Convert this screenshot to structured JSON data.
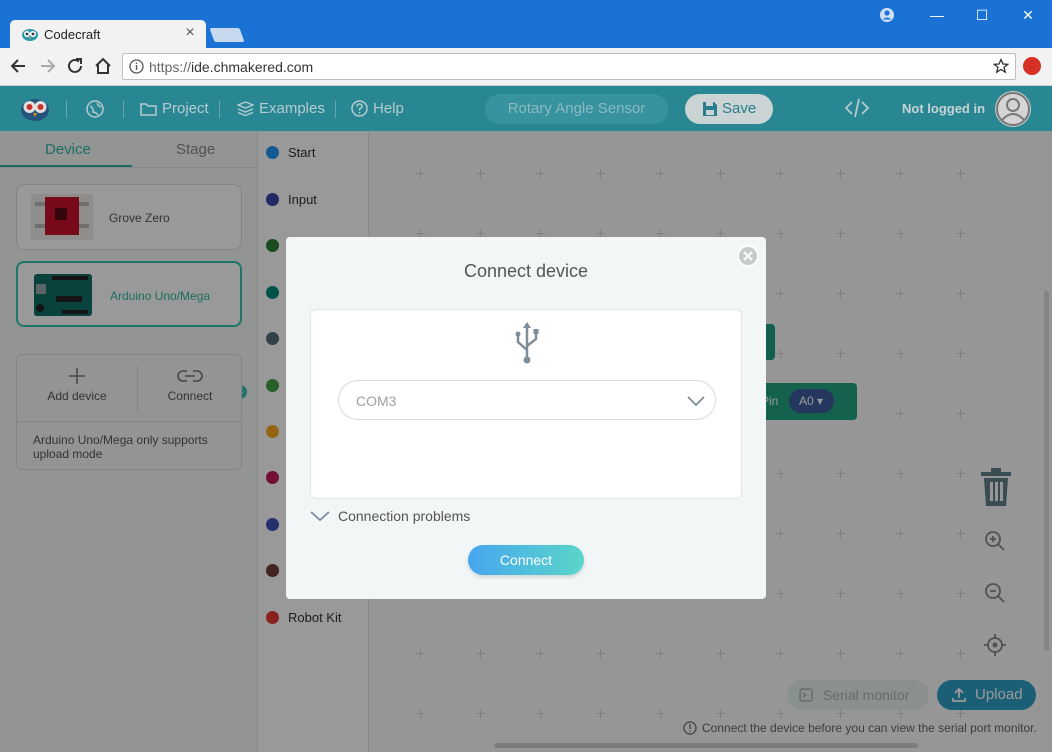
{
  "browser": {
    "tab_title": "Codecraft",
    "tab_close": "×",
    "url_protocol": "https://",
    "url_host": "ide.chmakered.com",
    "window_minimize": "—",
    "window_maximize": "☐",
    "window_close": "✕"
  },
  "header": {
    "menu": [
      {
        "label": "Project",
        "icon": "folder-icon"
      },
      {
        "label": "Examples",
        "icon": "layers-icon"
      },
      {
        "label": "Help",
        "icon": "help-icon"
      }
    ],
    "device_name": "Rotary Angle Sensor",
    "save_label": "Save",
    "login_status": "Not logged in"
  },
  "left_panel": {
    "tabs": [
      {
        "label": "Device",
        "active": true
      },
      {
        "label": "Stage",
        "active": false
      }
    ],
    "devices": [
      {
        "name": "Grove Zero",
        "selected": false
      },
      {
        "name": "Arduino Uno/Mega",
        "selected": true
      }
    ],
    "add_device_label": "Add device",
    "connect_label": "Connect",
    "note": "Arduino Uno/Mega  only supports upload mode"
  },
  "categories": [
    {
      "label": "Start",
      "color": "#2196f3"
    },
    {
      "label": "Input",
      "color": "#3949ab"
    },
    {
      "label": "",
      "color": "#2e7d32"
    },
    {
      "label": "",
      "color": "#00897b"
    },
    {
      "label": "",
      "color": "#546e7a"
    },
    {
      "label": "",
      "color": "#43a047"
    },
    {
      "label": "",
      "color": "#f9a825"
    },
    {
      "label": "",
      "color": "#c2185b"
    },
    {
      "label": "",
      "color": "#3f51b5"
    },
    {
      "label": "",
      "color": "#6d3b35"
    },
    {
      "label": "Robot Kit",
      "color": "#e53935"
    }
  ],
  "workspace": {
    "block_label": "Pin",
    "block_field": "A0",
    "serial_monitor_label": "Serial monitor",
    "upload_label": "Upload",
    "footer_note": "Connect the device before you can view the serial port monitor."
  },
  "modal": {
    "title": "Connect device",
    "port_value": "COM3",
    "connection_problems_label": "Connection problems",
    "connect_button": "Connect"
  }
}
